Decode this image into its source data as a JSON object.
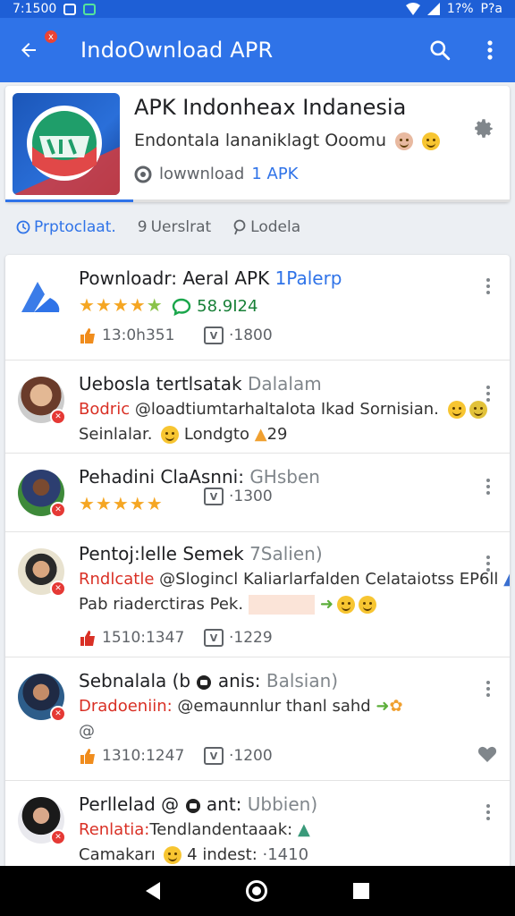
{
  "status_bar": {
    "time": "7:1500",
    "battery": "1?%",
    "right_text": "P?a"
  },
  "app_bar": {
    "title": "IndoOwnload APR",
    "badge": "x"
  },
  "header": {
    "title": "APK Indonheax Indanesia",
    "subtitle": "Endontala lananiklagt Ooomu",
    "download_label": "lowwnload",
    "download_count": "1 APK"
  },
  "tabs": [
    {
      "label": "Prptoclaat.",
      "icon": "clock-icon"
    },
    {
      "label": "Uerslrat",
      "icon": "9"
    },
    {
      "label": "Lodela",
      "icon": "pin-icon"
    }
  ],
  "items": [
    {
      "title": "Pownloadr: Aeral APK",
      "title_extra": "1Palerp",
      "stars": "★★★★",
      "rating_count": "58.9I24",
      "meta1": "13:0h351",
      "meta2": "·1800"
    },
    {
      "title": "Uebosla tertlsatak",
      "title_extra": "Dalalam",
      "handle": "Bodric",
      "text": "@loadtiumtarhaltalota Ikad Sornisian.",
      "line2": "Seinlalar.",
      "line2_extra": "Londgto",
      "line2_count": "29"
    },
    {
      "title": "Pehadini ClaAsnni:",
      "title_extra": "GHsben",
      "stars": "★★★★★",
      "meta2": "·1300"
    },
    {
      "title": "Pentoj:lelle Semek",
      "title_extra": "7Salien)",
      "handle": "Rndlcatle",
      "text": "@Slogincl Kaliarlarfalden Celataiotss EP6ll",
      "line2": "Pab riaderctiras Pek.",
      "meta1": "1510:1347",
      "meta2": "·1229"
    },
    {
      "title": "Sebnalala (b",
      "title_mid": "anis:",
      "title_extra": "Balsian)",
      "handle": "Dradoeniin:",
      "text": "@emaunnlur thanl sahd",
      "line2": "@",
      "meta1": "1310:1247",
      "meta2": "·1200"
    },
    {
      "title": "Perllelad @",
      "title_mid": "ant:",
      "title_extra": "Ubbien)",
      "handle": "Renlatia:",
      "text": "Tendlandentaaak:",
      "line2": "Camakarı",
      "line2_extra": "4 indest:",
      "line2_count": "·1410"
    }
  ],
  "colors": {
    "app_bar": "#2f73e8",
    "status_bar": "#1e5fd6",
    "accent_red": "#d93025",
    "star": "#f5a623"
  }
}
